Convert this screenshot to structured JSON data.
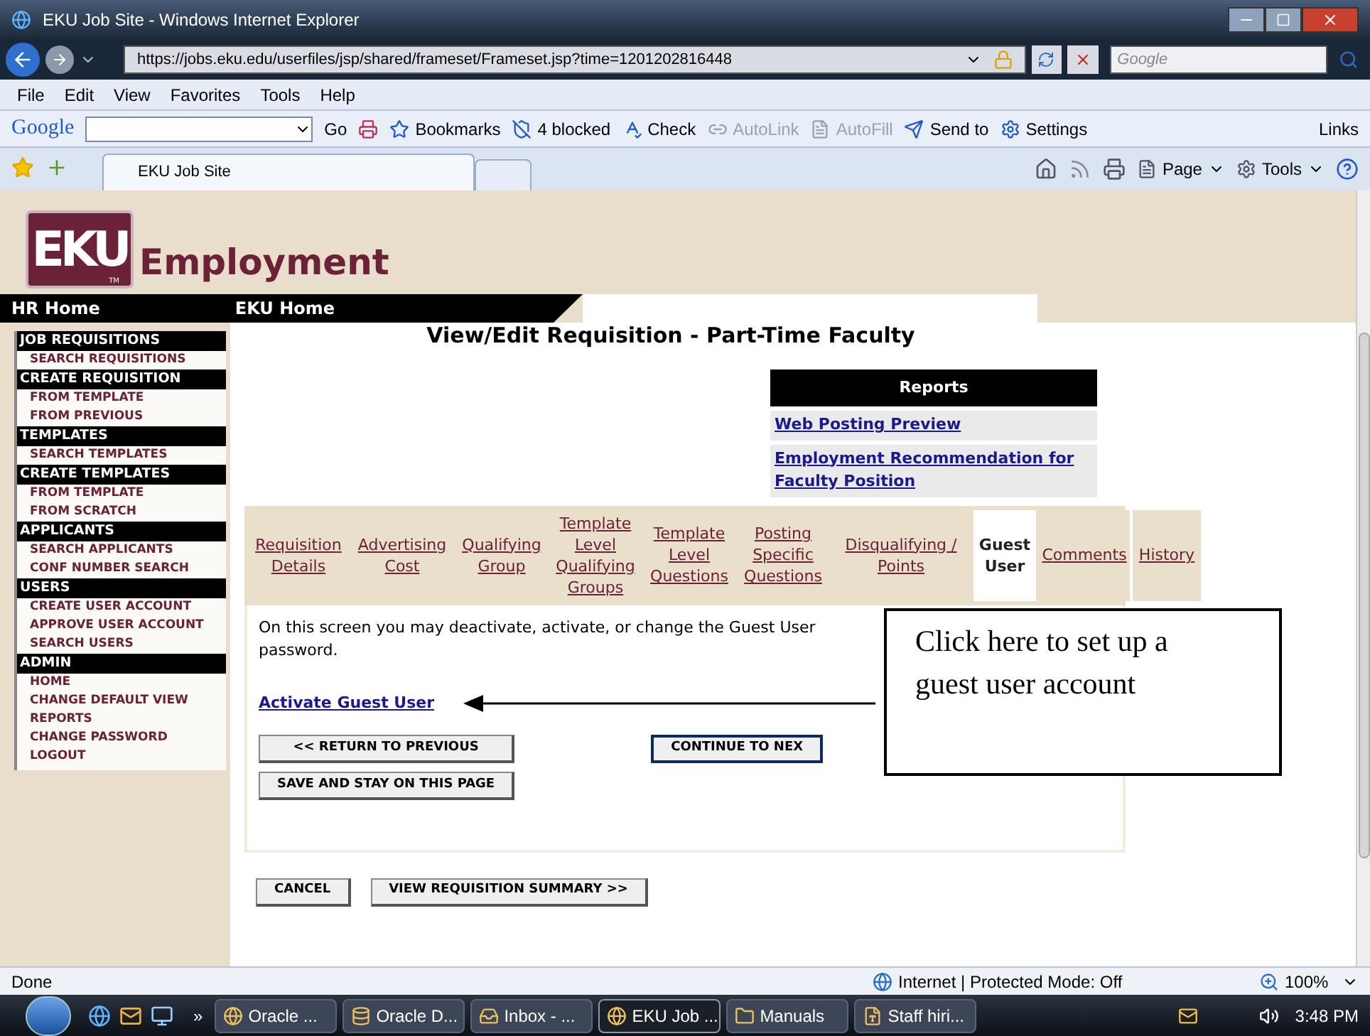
{
  "window": {
    "title": "EKU Job Site - Windows Internet Explorer"
  },
  "address_bar": {
    "url": "https://jobs.eku.edu/userfiles/jsp/shared/frameset/Frameset.jsp?time=1201202816448",
    "search_placeholder": "Google"
  },
  "menu": [
    "File",
    "Edit",
    "View",
    "Favorites",
    "Tools",
    "Help"
  ],
  "google_toolbar": {
    "logo": "Google",
    "go": "Go",
    "items": [
      {
        "label": "Bookmarks",
        "disabled": false
      },
      {
        "label": "4 blocked",
        "disabled": false
      },
      {
        "label": "Check",
        "disabled": false
      },
      {
        "label": "AutoLink",
        "disabled": true
      },
      {
        "label": "AutoFill",
        "disabled": true
      },
      {
        "label": "Send to",
        "disabled": false
      },
      {
        "label": "Settings",
        "disabled": false
      }
    ],
    "links": "Links"
  },
  "browser_tabs": [
    {
      "label": "EKU Job Site",
      "selected": true
    }
  ],
  "command_bar": [
    {
      "label": "Page"
    },
    {
      "label": "Tools"
    }
  ],
  "site": {
    "logo": "EKU",
    "trademark": "TM",
    "title": "Employment",
    "nav": [
      "HR Home",
      "EKU Home"
    ]
  },
  "sidebar": [
    {
      "heading": "JOB REQUISITIONS",
      "items": [
        "SEARCH REQUISITIONS"
      ]
    },
    {
      "heading": "CREATE REQUISITION",
      "items": [
        "FROM TEMPLATE",
        "FROM PREVIOUS"
      ]
    },
    {
      "heading": "TEMPLATES",
      "items": [
        "SEARCH TEMPLATES"
      ]
    },
    {
      "heading": "CREATE TEMPLATES",
      "items": [
        "FROM TEMPLATE",
        "FROM SCRATCH"
      ]
    },
    {
      "heading": "APPLICANTS",
      "items": [
        "SEARCH APPLICANTS",
        "CONF NUMBER SEARCH"
      ]
    },
    {
      "heading": "USERS",
      "items": [
        "CREATE USER ACCOUNT",
        "APPROVE USER ACCOUNT",
        "SEARCH USERS"
      ]
    },
    {
      "heading": "ADMIN",
      "items": [
        "HOME",
        "CHANGE DEFAULT VIEW",
        "REPORTS",
        "CHANGE PASSWORD",
        "LOGOUT"
      ]
    }
  ],
  "page_title": "View/Edit Requisition - Part-Time Faculty",
  "reports": {
    "heading": "Reports",
    "links": [
      "Web Posting Preview",
      "Employment Recommendation for Faculty Position"
    ]
  },
  "step_tabs": [
    {
      "label": "Requisition Details",
      "selected": false
    },
    {
      "label": "Advertising Cost",
      "selected": false
    },
    {
      "label": "Qualifying Group",
      "selected": false
    },
    {
      "label": "Template Level Qualifying Groups",
      "selected": false
    },
    {
      "label": "Template Level Questions",
      "selected": false
    },
    {
      "label": "Posting Specific Questions",
      "selected": false
    },
    {
      "label": "Disqualifying / Points",
      "selected": false
    },
    {
      "label": "Guest User",
      "selected": true
    },
    {
      "label": "Comments",
      "selected": false
    },
    {
      "label": "History",
      "selected": false
    }
  ],
  "panel": {
    "message": "On this screen you may deactivate, activate, or change the Guest User password.",
    "link": "Activate Guest User",
    "buttons": [
      {
        "label": "<< RETURN TO PREVIOUS",
        "kind": "normal"
      },
      {
        "label": "CONTINUE TO NEX",
        "kind": "default"
      },
      {
        "label": "SAVE AND STAY ON THIS PAGE",
        "kind": "normal"
      }
    ]
  },
  "callout": "Click here to set up a guest user account",
  "footer_buttons": [
    "CANCEL",
    "VIEW REQUISITION SUMMARY >>"
  ],
  "status_bar": {
    "status": "Done",
    "zone": "Internet | Protected Mode: Off",
    "zoom": "100%"
  },
  "taskbar": {
    "overflow": "»",
    "tasks": [
      {
        "label": "Oracle ...",
        "selected": false
      },
      {
        "label": "Oracle D...",
        "selected": false
      },
      {
        "label": "Inbox - ...",
        "selected": false
      },
      {
        "label": "EKU Job ...",
        "selected": true
      },
      {
        "label": "Manuals",
        "selected": false
      },
      {
        "label": "Staff hiri...",
        "selected": false
      }
    ],
    "clock": "3:48 PM"
  }
}
